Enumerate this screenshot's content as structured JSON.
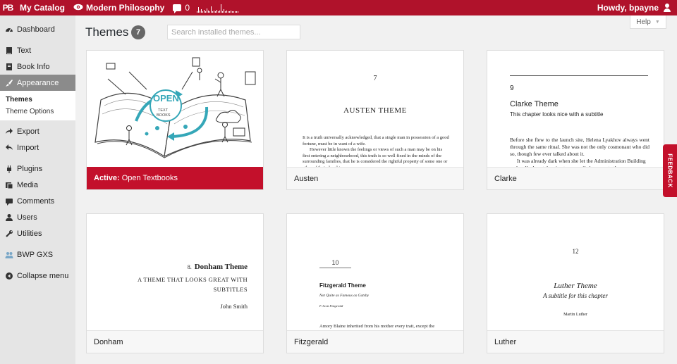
{
  "adminbar": {
    "logo": "PB",
    "catalog": "My Catalog",
    "book": "Modern Philosophy",
    "comments": "0",
    "greeting": "Howdy, bpayne"
  },
  "sidebar": {
    "items": [
      {
        "label": "Dashboard",
        "icon": "dashboard-icon"
      },
      {
        "label": "Text",
        "icon": "book-icon"
      },
      {
        "label": "Book Info",
        "icon": "book-info-icon"
      },
      {
        "label": "Appearance",
        "icon": "brush-icon"
      },
      {
        "label": "Export",
        "icon": "export-icon"
      },
      {
        "label": "Import",
        "icon": "import-icon"
      },
      {
        "label": "Plugins",
        "icon": "plugin-icon"
      },
      {
        "label": "Media",
        "icon": "media-icon"
      },
      {
        "label": "Comments",
        "icon": "comment-icon"
      },
      {
        "label": "Users",
        "icon": "users-icon"
      },
      {
        "label": "Utilities",
        "icon": "wrench-icon"
      },
      {
        "label": "BWP GXS",
        "icon": "group-icon"
      },
      {
        "label": "Collapse menu",
        "icon": "collapse-icon"
      }
    ],
    "submenu": [
      "Themes",
      "Theme Options"
    ]
  },
  "page": {
    "title": "Themes",
    "count": "7",
    "search_placeholder": "Search installed themes...",
    "help": "Help"
  },
  "themes": [
    {
      "name": "Open Textbooks",
      "active_prefix": "Active:",
      "illustration_text": "OPEN",
      "illustration_sub": "TEXT BOOKS"
    },
    {
      "name": "Austen",
      "chapter": "7",
      "heading": "AUSTEN THEME",
      "body": "It is a truth universally acknowledged, that a single man in possession of a good fortune, must be in want of a wife.",
      "body2": "However little known the feelings or views of such a man may be on his first entering a neighbourhood, this truth is so well fixed in the minds of the surrounding families, that he is considered the rightful property of some one or other of their daughters."
    },
    {
      "name": "Clarke",
      "chapter": "9",
      "heading": "Clarke Theme",
      "subtitle": "This chapter looks nice with a subtitle",
      "body": "Before she flew to the launch site, Helena Lyakhov always went through the same ritual. She was not the only cosmonaut who did so, though few ever talked about it.",
      "body2": "It was already dark when she let the Administration Building and walked past the pine trees, until she came to the"
    },
    {
      "name": "Donham",
      "chapter": "8.",
      "heading": "Donham Theme",
      "subtitle": "A THEME THAT LOOKS GREAT WITH SUBTITLES",
      "author": "John Smith"
    },
    {
      "name": "Fitzgerald",
      "chapter": "10",
      "heading": "Fitzgerald Theme",
      "subtitle": "Not Quite as Famous as Gatsby",
      "author": "F. Scott Fitzgerald",
      "body": "Amory Blaine inherited from his mother every trait, except the stray inexpressible few, that made him worth while. His father, an ineffectual"
    },
    {
      "name": "Luther",
      "chapter": "12",
      "heading": "Luther Theme",
      "subtitle": "A subtitle for this chapter",
      "author": "Martin Luther"
    }
  ],
  "feedback": "FEEDBACK",
  "colors": {
    "brand": "#b0122b",
    "active": "#c3102b"
  }
}
